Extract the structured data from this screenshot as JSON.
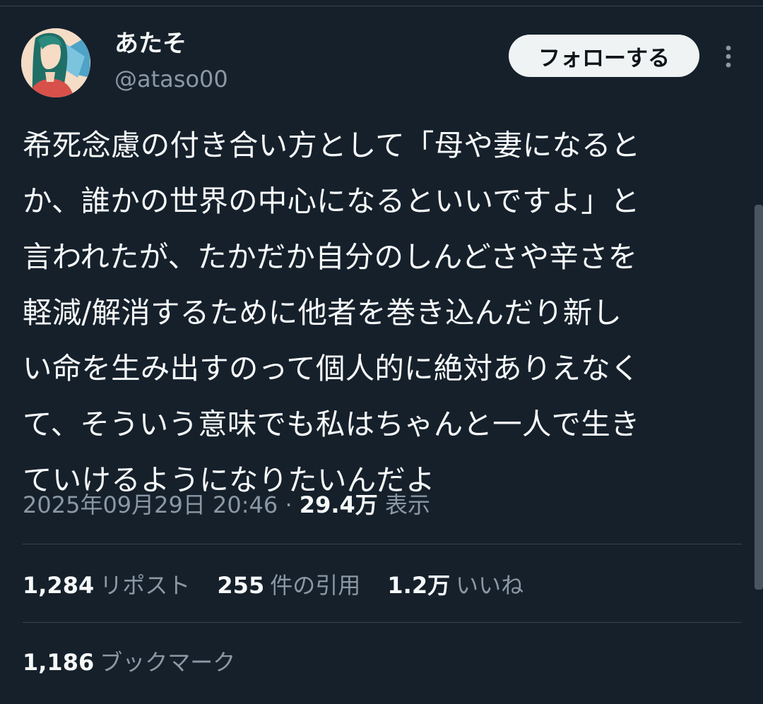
{
  "tweet": {
    "author": {
      "display_name": "あたそ",
      "handle": "@ataso00",
      "avatar_icon": "avatar-illustration"
    },
    "follow_label": "フォローする",
    "more_icon": "more-vertical-icon",
    "text_lines": [
      "希死念慮の付き合い方として「母や妻になると",
      "か、誰かの世界の中心になるといいですよ」と",
      "言われたが、たかだか自分のしんどさや辛さを",
      "軽減/解消するために他者を巻き込んだり新し",
      "い命を生み出すのって個人的に絶対ありえなく",
      "て、そういう意味でも私はちゃんと一人で生き",
      "ていけるようになりたいんだよ"
    ],
    "timestamp": "2025年09月29日 20:46",
    "separator": "·",
    "views_count": "29.4万",
    "views_label": "表示"
  },
  "stats": {
    "reposts": {
      "count": "1,284",
      "label": "リポスト"
    },
    "quotes": {
      "count": "255",
      "label": "件の引用"
    },
    "likes": {
      "count": "1.2万",
      "label": "いいね"
    },
    "bookmarks": {
      "count": "1,186",
      "label": "ブックマーク"
    }
  },
  "colors": {
    "background": "#15202b",
    "text_primary": "#f7f9f9",
    "text_secondary": "#8b98a5",
    "divider": "#38444d",
    "follow_button_bg": "#eff3f4"
  }
}
